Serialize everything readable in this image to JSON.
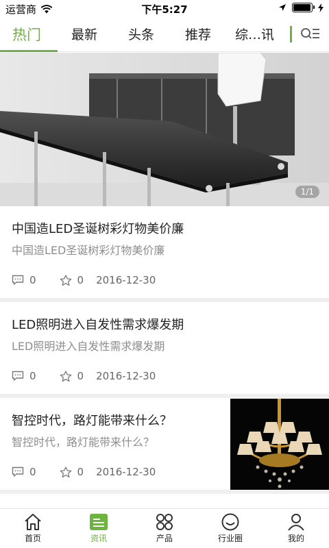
{
  "status_bar": {
    "carrier": "运营商",
    "time": "下午5:27",
    "battery_level": 0.95
  },
  "tabs": [
    {
      "label": "热门",
      "active": true
    },
    {
      "label": "最新",
      "active": false
    },
    {
      "label": "头条",
      "active": false
    },
    {
      "label": "推荐",
      "active": false
    },
    {
      "label": "综…讯",
      "active": false
    }
  ],
  "hero": {
    "pager": "1/1"
  },
  "articles": [
    {
      "title": "中国造LED圣诞树彩灯物美价廉",
      "summary": "中国造LED圣诞树彩灯物美价廉",
      "comments": "0",
      "likes": "0",
      "date": "2016-12-30",
      "has_thumbnail": false
    },
    {
      "title": "LED照明进入自发性需求爆发期",
      "summary": "LED照明进入自发性需求爆发期",
      "comments": "0",
      "likes": "0",
      "date": "2016-12-30",
      "has_thumbnail": false
    },
    {
      "title": "智控时代，路灯能带来什么？",
      "summary": "智控时代，路灯能带来什么？",
      "comments": "0",
      "likes": "0",
      "date": "2016-12-30",
      "has_thumbnail": true
    }
  ],
  "bottom_nav": [
    {
      "label": "首页",
      "icon": "home-icon",
      "active": false
    },
    {
      "label": "资讯",
      "icon": "news-icon",
      "active": true
    },
    {
      "label": "产品",
      "icon": "products-icon",
      "active": false
    },
    {
      "label": "行业圈",
      "icon": "industry-circle-icon",
      "active": false
    },
    {
      "label": "我的",
      "icon": "profile-icon",
      "active": false
    }
  ],
  "colors": {
    "accent": "#6db33f",
    "separator": "#efefef",
    "summary_text": "#8e8e8e"
  }
}
